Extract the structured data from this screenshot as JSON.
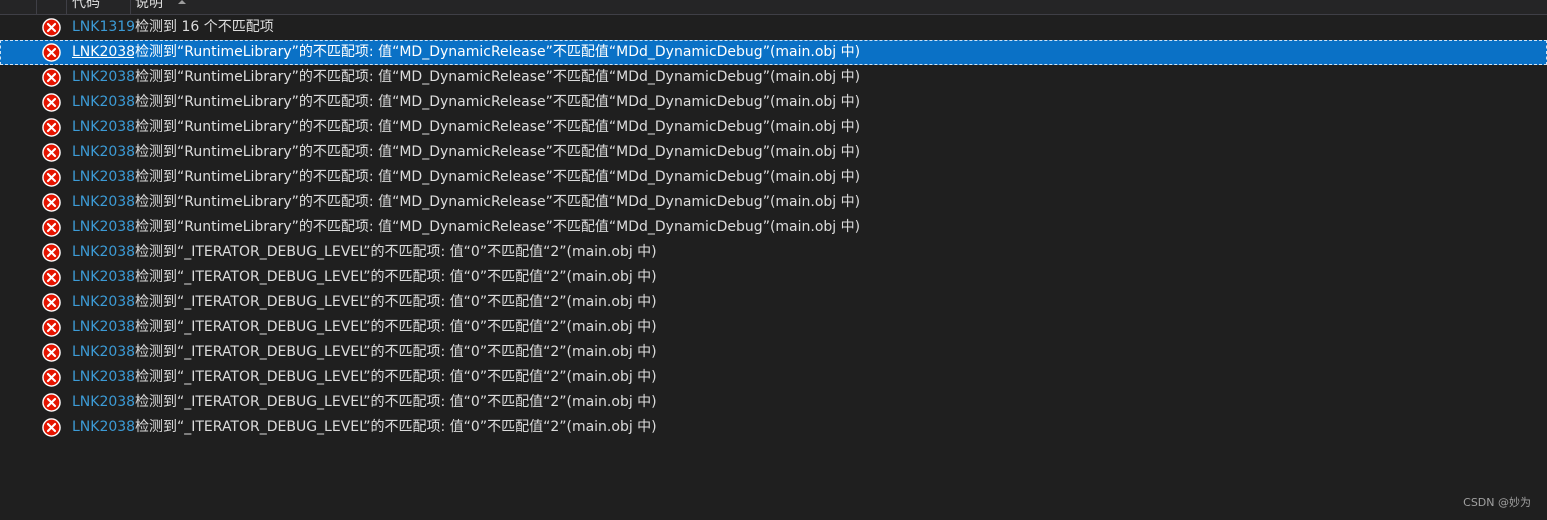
{
  "columns": {
    "code_header": "代码",
    "desc_header": "说明"
  },
  "colors": {
    "background": "#1f1f1f",
    "selection": "#0a71c6",
    "link": "#3c9bd6",
    "error_icon": "#e51400"
  },
  "rows": [
    {
      "icon": "error-icon",
      "code": "LNK1319",
      "desc": "检测到 16 个不匹配项",
      "selected": false
    },
    {
      "icon": "error-icon",
      "code": "LNK2038",
      "desc": "检测到“RuntimeLibrary”的不匹配项: 值“MD_DynamicRelease”不匹配值“MDd_DynamicDebug”(main.obj 中)",
      "selected": true
    },
    {
      "icon": "error-icon",
      "code": "LNK2038",
      "desc": "检测到“RuntimeLibrary”的不匹配项: 值“MD_DynamicRelease”不匹配值“MDd_DynamicDebug”(main.obj 中)",
      "selected": false
    },
    {
      "icon": "error-icon",
      "code": "LNK2038",
      "desc": "检测到“RuntimeLibrary”的不匹配项: 值“MD_DynamicRelease”不匹配值“MDd_DynamicDebug”(main.obj 中)",
      "selected": false
    },
    {
      "icon": "error-icon",
      "code": "LNK2038",
      "desc": "检测到“RuntimeLibrary”的不匹配项: 值“MD_DynamicRelease”不匹配值“MDd_DynamicDebug”(main.obj 中)",
      "selected": false
    },
    {
      "icon": "error-icon",
      "code": "LNK2038",
      "desc": "检测到“RuntimeLibrary”的不匹配项: 值“MD_DynamicRelease”不匹配值“MDd_DynamicDebug”(main.obj 中)",
      "selected": false
    },
    {
      "icon": "error-icon",
      "code": "LNK2038",
      "desc": "检测到“RuntimeLibrary”的不匹配项: 值“MD_DynamicRelease”不匹配值“MDd_DynamicDebug”(main.obj 中)",
      "selected": false
    },
    {
      "icon": "error-icon",
      "code": "LNK2038",
      "desc": "检测到“RuntimeLibrary”的不匹配项: 值“MD_DynamicRelease”不匹配值“MDd_DynamicDebug”(main.obj 中)",
      "selected": false
    },
    {
      "icon": "error-icon",
      "code": "LNK2038",
      "desc": "检测到“RuntimeLibrary”的不匹配项: 值“MD_DynamicRelease”不匹配值“MDd_DynamicDebug”(main.obj 中)",
      "selected": false
    },
    {
      "icon": "error-icon",
      "code": "LNK2038",
      "desc": "检测到“_ITERATOR_DEBUG_LEVEL”的不匹配项: 值“0”不匹配值“2”(main.obj 中)",
      "selected": false
    },
    {
      "icon": "error-icon",
      "code": "LNK2038",
      "desc": "检测到“_ITERATOR_DEBUG_LEVEL”的不匹配项: 值“0”不匹配值“2”(main.obj 中)",
      "selected": false
    },
    {
      "icon": "error-icon",
      "code": "LNK2038",
      "desc": "检测到“_ITERATOR_DEBUG_LEVEL”的不匹配项: 值“0”不匹配值“2”(main.obj 中)",
      "selected": false
    },
    {
      "icon": "error-icon",
      "code": "LNK2038",
      "desc": "检测到“_ITERATOR_DEBUG_LEVEL”的不匹配项: 值“0”不匹配值“2”(main.obj 中)",
      "selected": false
    },
    {
      "icon": "error-icon",
      "code": "LNK2038",
      "desc": "检测到“_ITERATOR_DEBUG_LEVEL”的不匹配项: 值“0”不匹配值“2”(main.obj 中)",
      "selected": false
    },
    {
      "icon": "error-icon",
      "code": "LNK2038",
      "desc": "检测到“_ITERATOR_DEBUG_LEVEL”的不匹配项: 值“0”不匹配值“2”(main.obj 中)",
      "selected": false
    },
    {
      "icon": "error-icon",
      "code": "LNK2038",
      "desc": "检测到“_ITERATOR_DEBUG_LEVEL”的不匹配项: 值“0”不匹配值“2”(main.obj 中)",
      "selected": false
    },
    {
      "icon": "error-icon",
      "code": "LNK2038",
      "desc": "检测到“_ITERATOR_DEBUG_LEVEL”的不匹配项: 值“0”不匹配值“2”(main.obj 中)",
      "selected": false
    }
  ],
  "watermark": "CSDN @妙为"
}
